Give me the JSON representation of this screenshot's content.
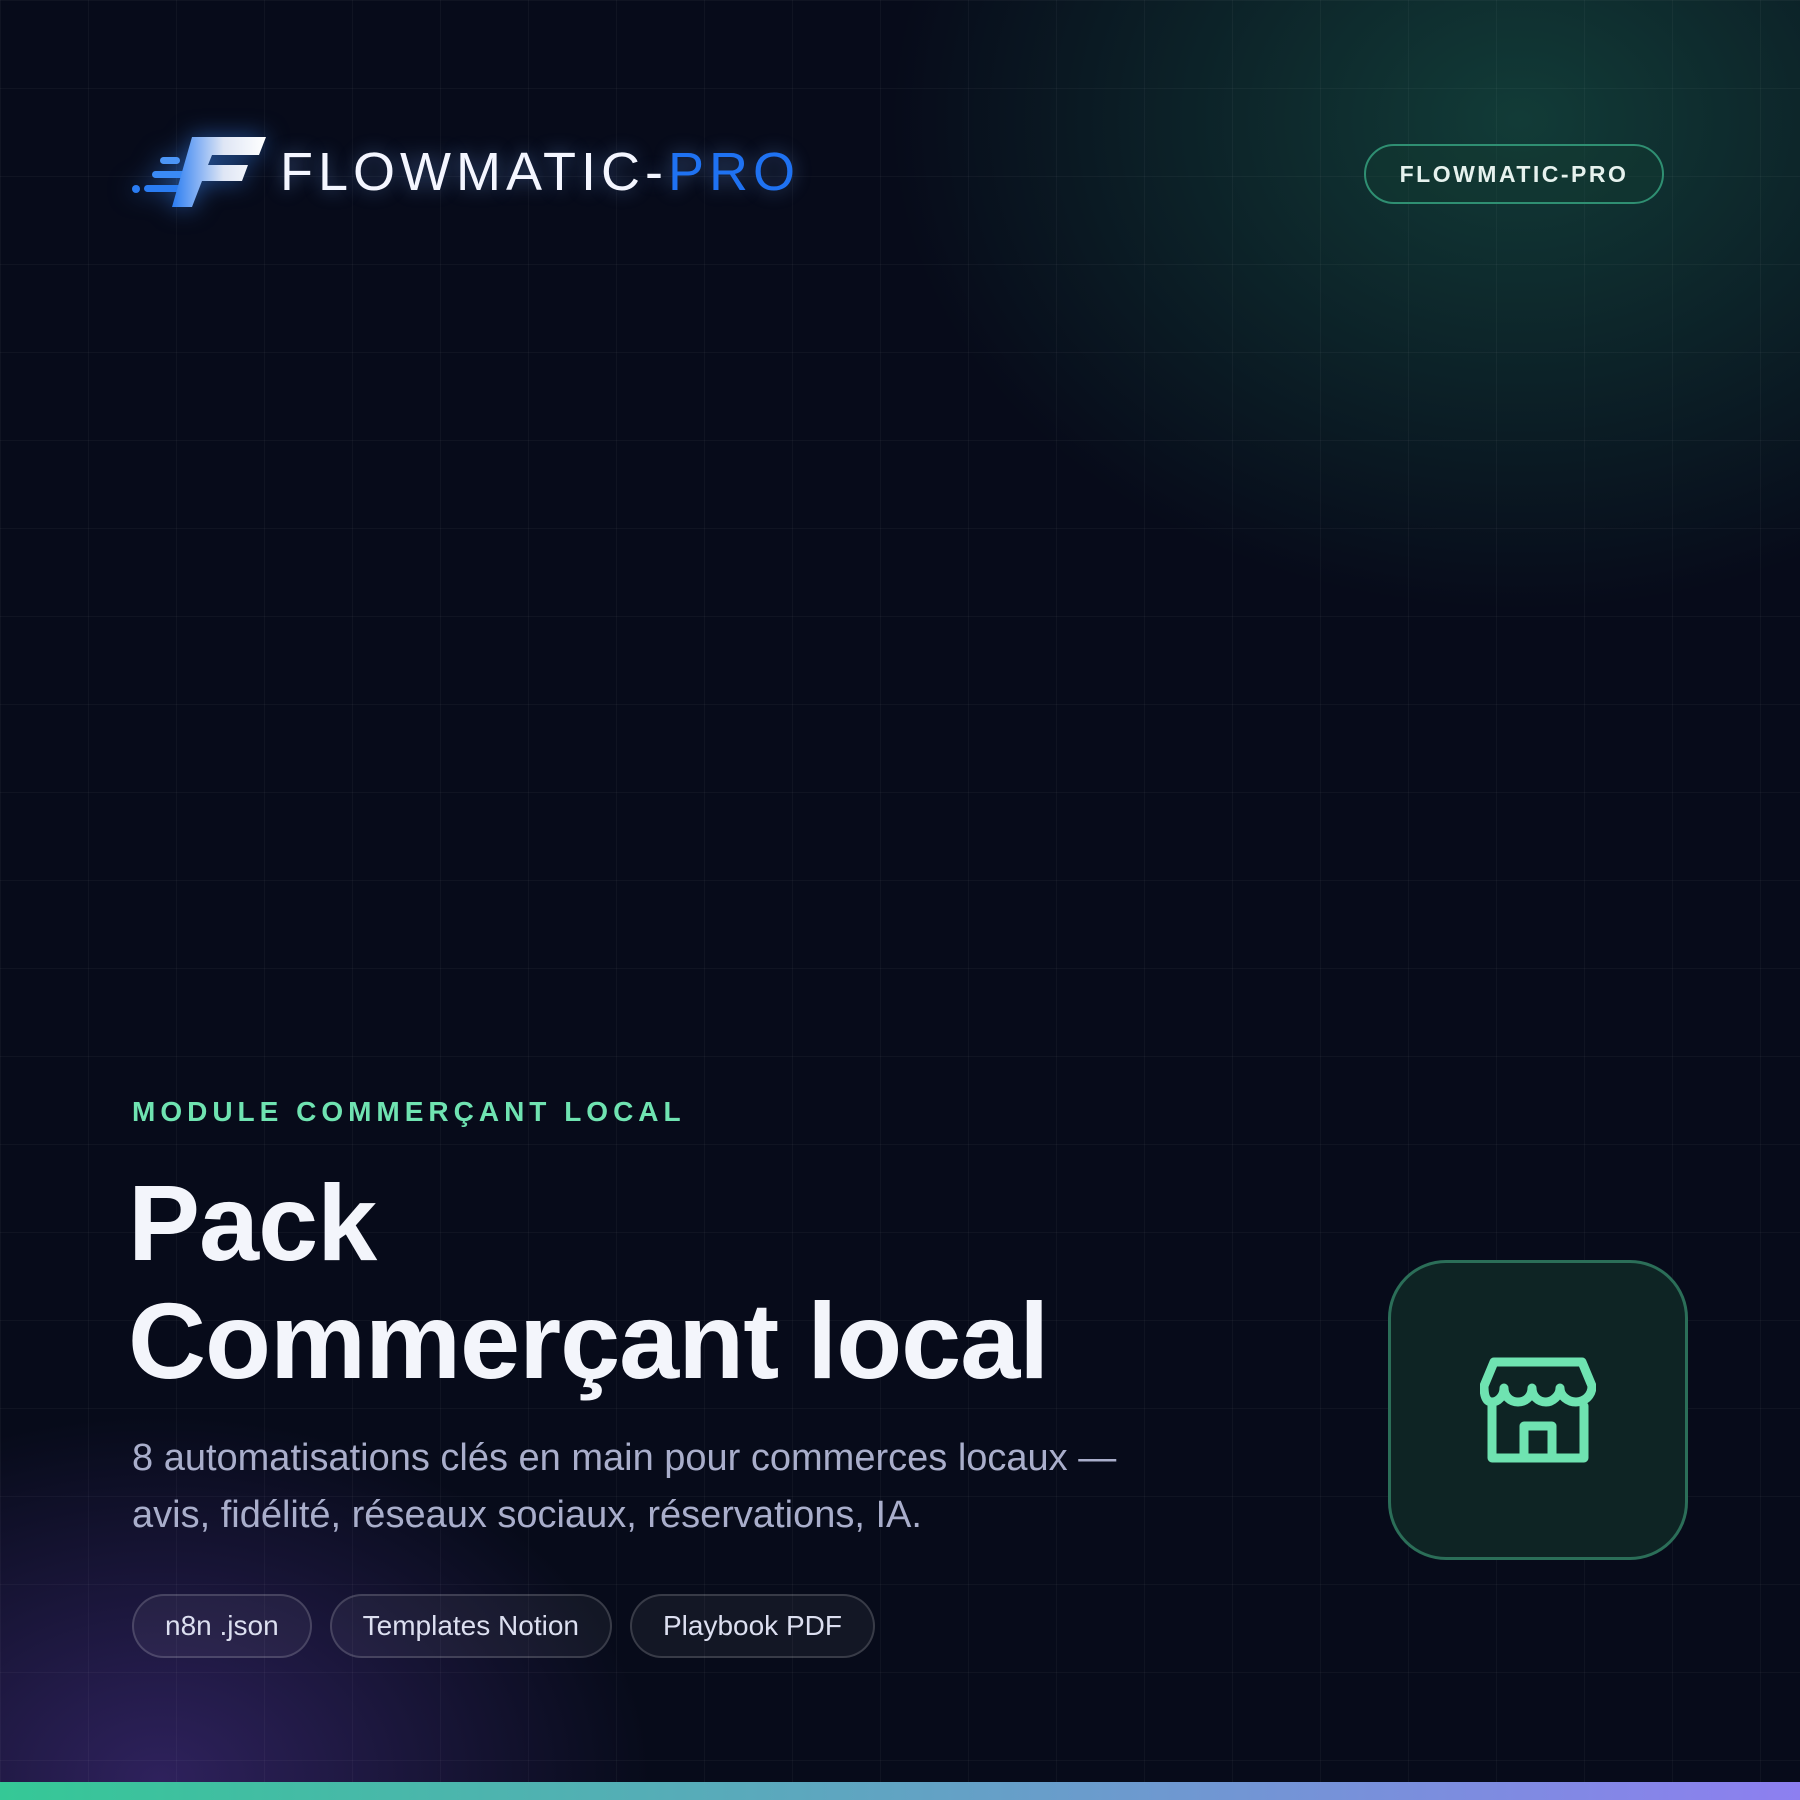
{
  "header": {
    "logo_text_main": "FLOWMATIC-",
    "logo_text_accent": "PRO",
    "badge_label": "FLOWMATIC-PRO"
  },
  "hero": {
    "eyebrow": "MODULE COMMERÇANT LOCAL",
    "title_line1": "Pack",
    "title_line2": "Commerçant local",
    "subtitle": "8 automatisations clés en main pour commerces locaux — avis, fidélité, réseaux sociaux, réservations, IA.",
    "chips": [
      "n8n .json",
      "Templates Notion",
      "Playbook PDF"
    ],
    "icon": "storefront-icon"
  },
  "colors": {
    "background": "#070b1a",
    "accent_green": "#6fe3b1",
    "accent_blue": "#1f72f2",
    "bar_start": "#35c896",
    "bar_end": "#8d7ff0"
  }
}
